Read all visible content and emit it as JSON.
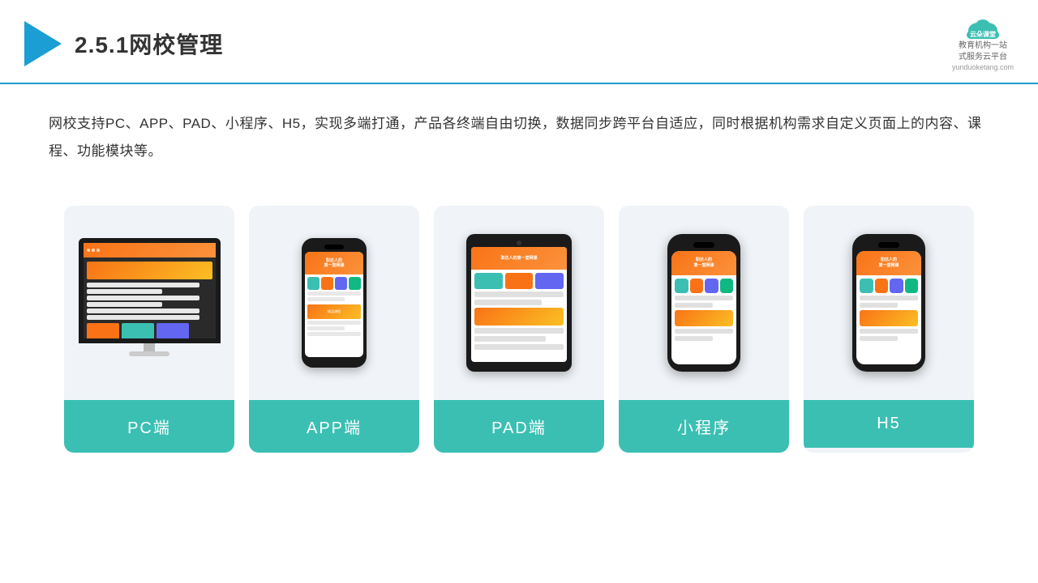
{
  "header": {
    "title": "2.5.1网校管理",
    "brand_name": "云朵课堂",
    "brand_url": "yunduoketang.com",
    "brand_tagline": "教育机构一站\n式服务云平台"
  },
  "description": {
    "text": "网校支持PC、APP、PAD、小程序、H5，实现多端打通，产品各终端自由切换，数据同步跨平台自适应，同时根据机构需求自定义页面上的内容、课程、功能模块等。"
  },
  "cards": [
    {
      "label": "PC端",
      "type": "pc"
    },
    {
      "label": "APP端",
      "type": "phone"
    },
    {
      "label": "PAD端",
      "type": "tablet"
    },
    {
      "label": "小程序",
      "type": "phone_modern"
    },
    {
      "label": "H5",
      "type": "phone_modern2"
    }
  ],
  "screen_content": {
    "phone_text_line1": "职达人的",
    "phone_text_line2": "第一堂网课"
  }
}
